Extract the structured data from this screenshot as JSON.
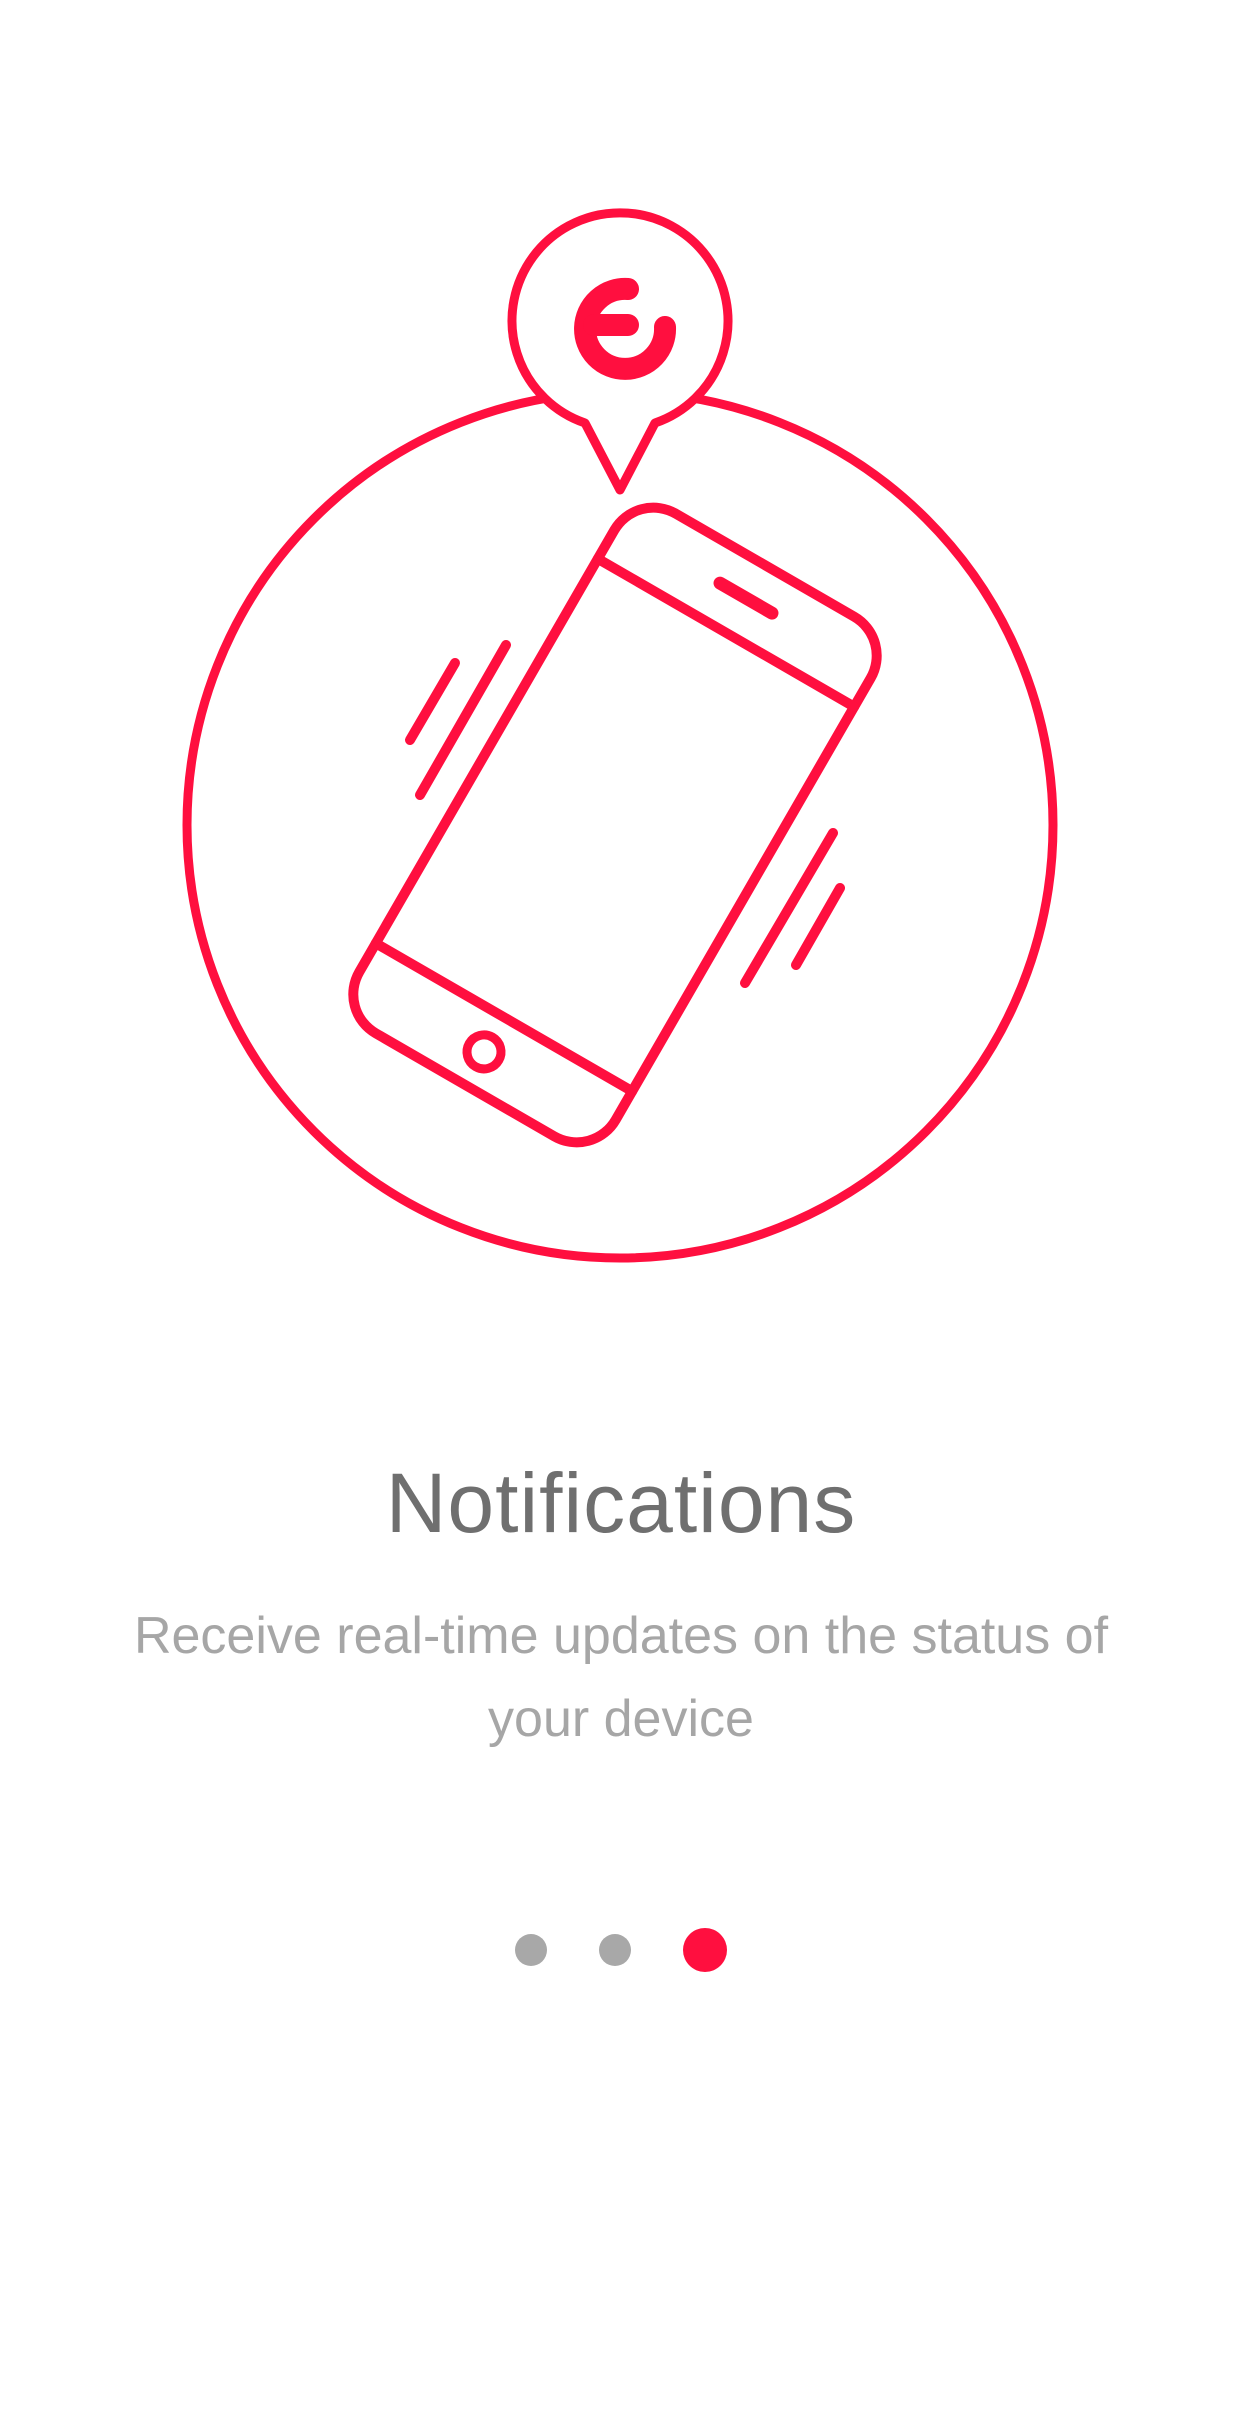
{
  "theme": {
    "accent": "#ff0f3f",
    "title_color": "#6f6f6f",
    "body_color": "#a6a6a6",
    "dot_inactive": "#a8a8a8"
  },
  "illustration": {
    "icons": [
      "logo-pin-icon",
      "vibrating-phone-icon"
    ]
  },
  "onboarding": {
    "title": "Notifications",
    "description": "Receive real-time updates on the status of your device"
  },
  "pager": {
    "total_pages": 3,
    "current_page": 3
  }
}
